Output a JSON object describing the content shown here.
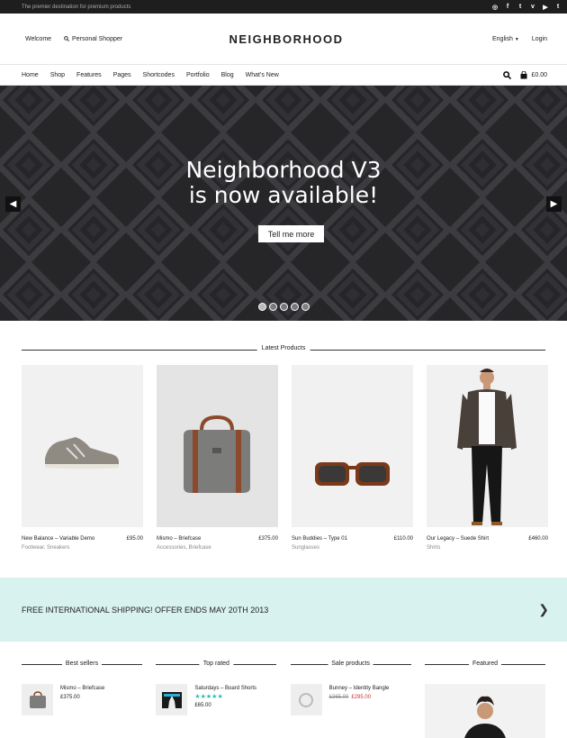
{
  "topbar": {
    "tagline": "The premier destination for premium products",
    "social": [
      "dribbble-icon",
      "facebook-icon",
      "twitter-icon",
      "vimeo-icon",
      "youtube-icon",
      "tumblr-icon"
    ],
    "social_glyphs": [
      "◎",
      "f",
      "t",
      "v",
      "▶",
      "t"
    ]
  },
  "header": {
    "welcome": "Welcome",
    "shopper": "Personal Shopper",
    "logo": "NEIGHBORHOOD",
    "language": "English",
    "login": "Login"
  },
  "nav": {
    "items": [
      "Home",
      "Shop",
      "Features",
      "Pages",
      "Shortcodes",
      "Portfolio",
      "Blog",
      "What's New"
    ],
    "cart": "£0.00"
  },
  "hero": {
    "title_line1": "Neighborhood V3",
    "title_line2": "is now available!",
    "button": "Tell me more",
    "slides": 5,
    "active_slide": 1
  },
  "latest": {
    "heading": "Latest Products",
    "products": [
      {
        "name": "New Balance – Variable Demo",
        "price": "£95.00",
        "category": "Footwear, Sneakers"
      },
      {
        "name": "Mismo – Briefcase",
        "price": "£375.00",
        "category": "Accessories, Briefcase"
      },
      {
        "name": "Sun Buddies – Type 01",
        "price": "£110.00",
        "category": "Sunglasses"
      },
      {
        "name": "Our Legacy – Suede Shirt",
        "price": "£460.00",
        "category": "Shirts"
      }
    ]
  },
  "promo": {
    "text": "FREE INTERNATIONAL SHIPPING! OFFER ENDS MAY 20TH 2013"
  },
  "widgets": {
    "best": {
      "heading": "Best sellers",
      "name": "Mismo – Briefcase",
      "price": "£375.00"
    },
    "top": {
      "heading": "Top rated",
      "name": "Saturdays – Board Shorts",
      "rating": 5,
      "price": "£65.00"
    },
    "sale": {
      "heading": "Sale products",
      "name": "Bunney – Identity Bangle",
      "old_price": "£365.00",
      "price": "£295.00"
    },
    "featured": {
      "heading": "Featured"
    }
  },
  "colors": {
    "accent": "#2bbfb3",
    "promo_bg": "#d8f2f0",
    "topbar_bg": "#1e1e1e"
  }
}
